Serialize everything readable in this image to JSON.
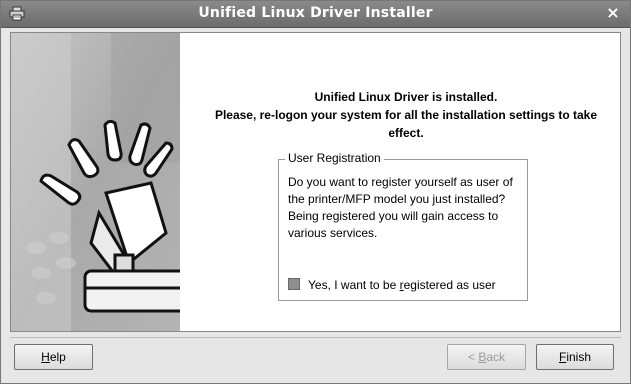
{
  "window": {
    "title": "Unified Linux Driver Installer",
    "close_symbol": "×",
    "title_icon": "printer-icon",
    "close_icon": "close-icon"
  },
  "message": {
    "line1": "Unified Linux Driver is installed.",
    "line2": "Please, re-logon your system for all the installation settings to take",
    "line3": "effect."
  },
  "registration": {
    "legend": "User Registration",
    "text": [
      "Do you want to register yourself as user of",
      "the printer/MFP model you just installed?",
      "Being registered you will gain access to",
      "various services."
    ],
    "checkbox_before": "Yes, I want to be ",
    "checkbox_mnemonic": "r",
    "checkbox_after": "egistered as user",
    "checkbox_checked": false
  },
  "buttons": {
    "help_mnemonic": "H",
    "help_rest": "elp",
    "back_prefix": "< ",
    "back_mnemonic": "B",
    "back_rest": "ack",
    "finish_mnemonic": "F",
    "finish_rest": "inish"
  },
  "colors": {
    "titlebar": "#7a7a7a",
    "background": "#e6e6e6",
    "content": "#ffffff"
  }
}
